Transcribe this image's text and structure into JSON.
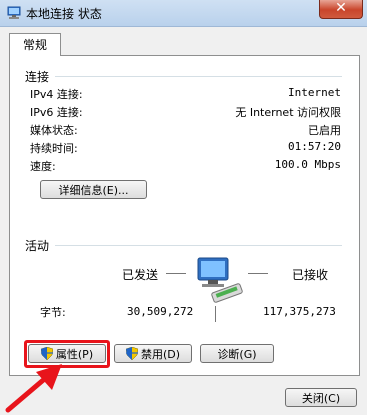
{
  "window": {
    "title": "本地连接 状态",
    "close_glyph": "✕"
  },
  "tabs": [
    {
      "label": "常规"
    }
  ],
  "connection": {
    "section_title": "连接",
    "rows": [
      {
        "label": "IPv4 连接:",
        "value": "Internet"
      },
      {
        "label": "IPv6 连接:",
        "value": "无 Internet 访问权限"
      },
      {
        "label": "媒体状态:",
        "value": "已启用"
      },
      {
        "label": "持续时间:",
        "value": "01:57:20"
      },
      {
        "label": "速度:",
        "value": "100.0 Mbps"
      }
    ],
    "details_button": "详细信息(E)..."
  },
  "activity": {
    "section_title": "活动",
    "sent_label": "已发送",
    "received_label": "已接收",
    "bytes_label": "字节:",
    "bytes_sent": "30,509,272",
    "bytes_received": "117,375,273"
  },
  "buttons": {
    "properties": "属性(P)",
    "disable": "禁用(D)",
    "diagnose": "诊断(G)",
    "close": "关闭(C)"
  },
  "colors": {
    "highlight": "#e8141b",
    "arrow": "#e8141b"
  }
}
